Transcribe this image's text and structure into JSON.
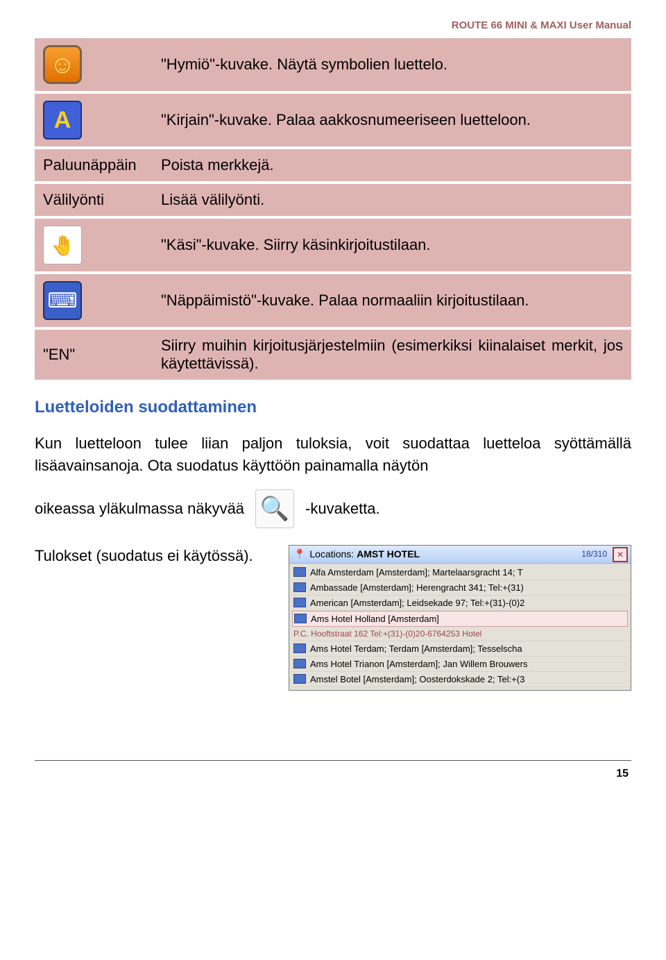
{
  "header": {
    "title": "ROUTE 66 MINI & MAXI User Manual"
  },
  "table": {
    "rows": [
      {
        "key_kind": "icon",
        "icon": "smile",
        "desc": "\"Hymiö\"-kuvake. Näytä symbolien luettelo."
      },
      {
        "key_kind": "icon",
        "icon": "letter",
        "desc": "\"Kirjain\"-kuvake. Palaa aakkosnumeeriseen luetteloon."
      },
      {
        "key_kind": "text",
        "key": "Paluunäppäin",
        "desc": "Poista merkkejä."
      },
      {
        "key_kind": "text",
        "key": "Välilyönti",
        "desc": "Lisää välilyönti."
      },
      {
        "key_kind": "icon",
        "icon": "hand",
        "desc": "\"Käsi\"-kuvake. Siirry käsinkirjoitustilaan."
      },
      {
        "key_kind": "icon",
        "icon": "kb",
        "desc": "\"Näppäimistö\"-kuvake. Palaa normaaliin kirjoitustilaan."
      },
      {
        "key_kind": "text",
        "key": "\"EN\"",
        "desc": "Siirry muihin kirjoitusjärjestelmiin (esimerkiksi kiinalaiset merkit, jos käytettävissä)."
      }
    ]
  },
  "section_heading": "Luetteloiden suodattaminen",
  "body_paragraph": "Kun luetteloon tulee liian paljon tuloksia, voit suodattaa luetteloa syöttämällä lisäavainsanoja. Ota suodatus käyttöön painamalla näytön",
  "inline": {
    "before": "oikeassa yläkulmassa näkyvää",
    "after": "-kuvaketta."
  },
  "results_label": "Tulokset (suodatus ei käytössä).",
  "screenshot": {
    "title_prefix": "Locations:",
    "title_query": "AMST HOTEL",
    "count": "18/310",
    "items": [
      {
        "text": "Alfa Amsterdam [Amsterdam]; Martelaarsgracht 14; T"
      },
      {
        "text": "Ambassade [Amsterdam]; Herengracht 341; Tel:+(31)"
      },
      {
        "text": "American [Amsterdam]; Leidsekade 97; Tel:+(31)-(0)2"
      },
      {
        "text": "Ams Hotel Holland [Amsterdam]",
        "selected": true,
        "sub": "P.C. Hooftstraat 162 Tel:+(31)-(0)20-6764253 Hotel"
      },
      {
        "text": "Ams Hotel Terdam; Terdam [Amsterdam]; Tesselscha"
      },
      {
        "text": "Ams Hotel Trianon [Amsterdam]; Jan Willem Brouwers"
      },
      {
        "text": "Amstel Botel [Amsterdam]; Oosterdokskade 2; Tel:+(3"
      }
    ]
  },
  "page_number": "15"
}
